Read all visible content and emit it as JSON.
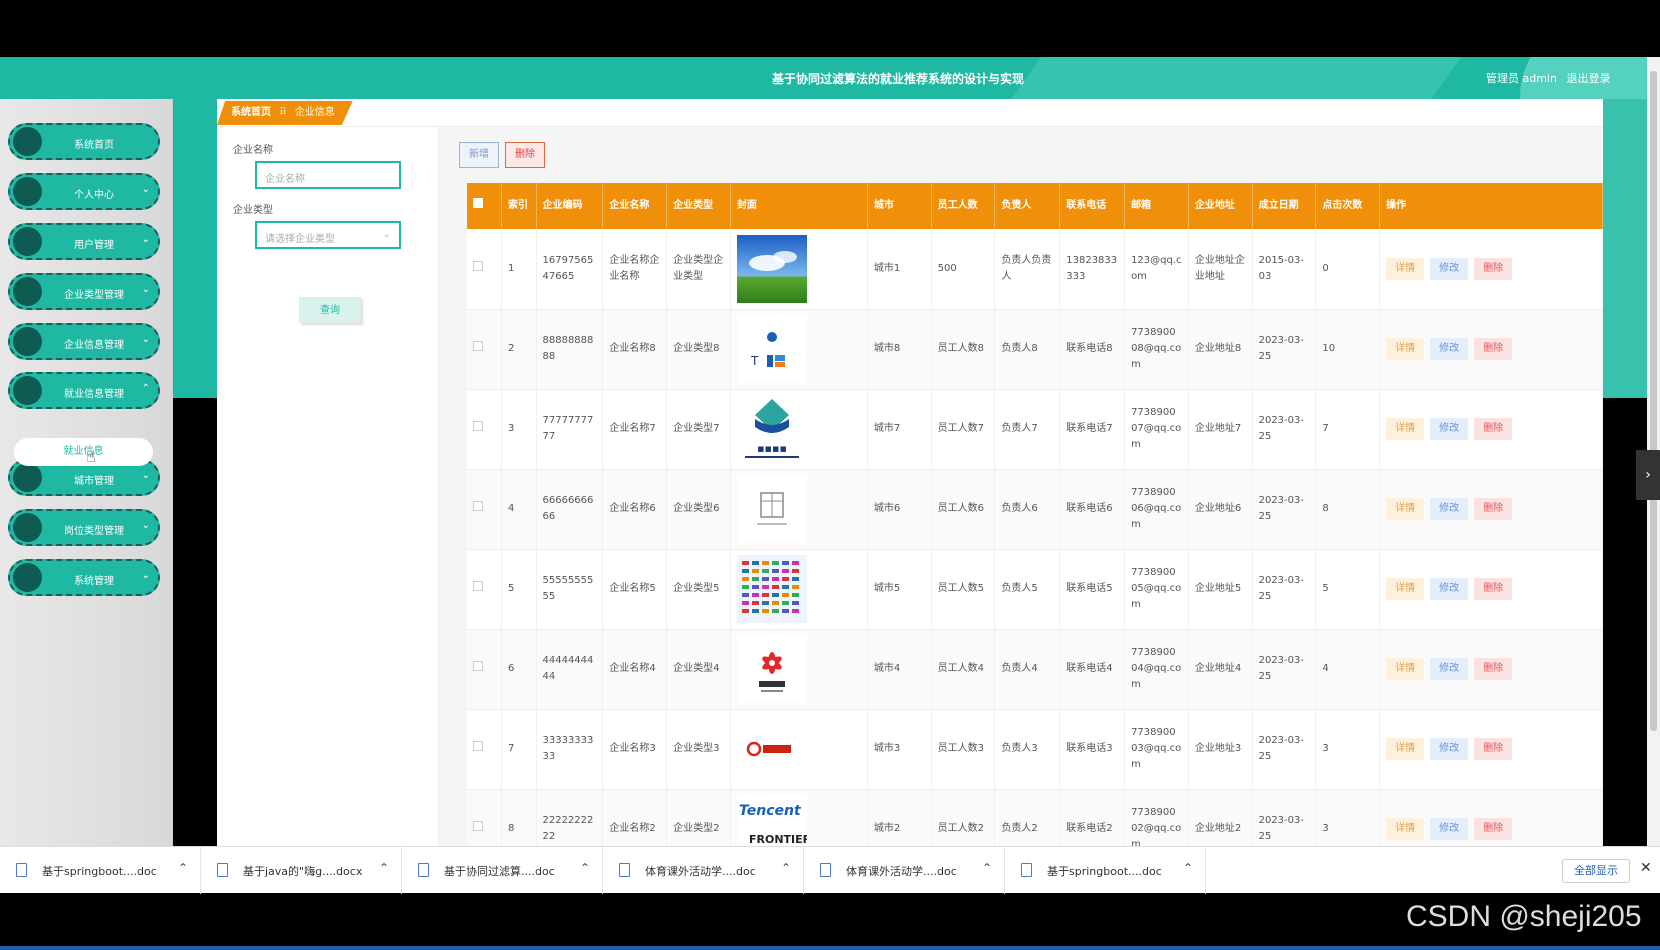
{
  "header": {
    "title": "基于协同过滤算法的就业推荐系统的设计与实现",
    "user": "管理员 admin",
    "logout": "退出登录"
  },
  "sidebar": {
    "items": [
      {
        "label": "系统首页"
      },
      {
        "label": "个人中心"
      },
      {
        "label": "用户管理"
      },
      {
        "label": "企业类型管理"
      },
      {
        "label": "企业信息管理"
      },
      {
        "label": "就业信息管理"
      },
      {
        "label": "城市管理"
      },
      {
        "label": "岗位类型管理"
      },
      {
        "label": "系统管理"
      }
    ],
    "sub_item": "就业信息"
  },
  "breadcrumb": {
    "home": "系统首页",
    "sep": "⠿",
    "current": "企业信息"
  },
  "search": {
    "name_label": "企业名称",
    "name_placeholder": "企业名称",
    "type_label": "企业类型",
    "type_placeholder": "请选择企业类型",
    "query": "查询"
  },
  "toolbar": {
    "add": "新增",
    "delete": "删除"
  },
  "table": {
    "headers": [
      "索引",
      "企业编码",
      "企业名称",
      "企业类型",
      "封面",
      "城市",
      "员工人数",
      "负责人",
      "联系电话",
      "邮箱",
      "企业地址",
      "成立日期",
      "点击次数",
      "操作"
    ],
    "ops": {
      "detail": "详情",
      "edit": "修改",
      "remove": "删除"
    },
    "rows": [
      {
        "idx": "1",
        "code": "1679756547665",
        "name": "企业名称企业名称",
        "type": "企业类型企业类型",
        "city": "城市1",
        "staff": "500",
        "owner": "负责人负责人",
        "phone": "13823833333",
        "email": "123@qq.com",
        "addr": "企业地址企业地址",
        "date": "2015-03-03",
        "clicks": "0",
        "cover": "sky"
      },
      {
        "idx": "2",
        "code": "8888888888",
        "name": "企业名称8",
        "type": "企业类型8",
        "city": "城市8",
        "staff": "员工人数8",
        "owner": "负责人8",
        "phone": "联系电话8",
        "email": "773890008@qq.com",
        "addr": "企业地址8",
        "date": "2023-03-25",
        "clicks": "10",
        "cover": "logo-t"
      },
      {
        "idx": "3",
        "code": "7777777777",
        "name": "企业名称7",
        "type": "企业类型7",
        "city": "城市7",
        "staff": "员工人数7",
        "owner": "负责人7",
        "phone": "联系电话7",
        "email": "773890007@qq.com",
        "addr": "企业地址7",
        "date": "2023-03-25",
        "clicks": "7",
        "cover": "zhishang"
      },
      {
        "idx": "4",
        "code": "6666666666",
        "name": "企业名称6",
        "type": "企业类型6",
        "city": "城市6",
        "staff": "员工人数6",
        "owner": "负责人6",
        "phone": "联系电话6",
        "email": "773890006@qq.com",
        "addr": "企业地址6",
        "date": "2023-03-25",
        "clicks": "8",
        "cover": "building"
      },
      {
        "idx": "5",
        "code": "5555555555",
        "name": "企业名称5",
        "type": "企业类型5",
        "city": "城市5",
        "staff": "员工人数5",
        "owner": "负责人5",
        "phone": "联系电话5",
        "email": "773890005@qq.com",
        "addr": "企业地址5",
        "date": "2023-03-25",
        "clicks": "5",
        "cover": "logos"
      },
      {
        "idx": "6",
        "code": "4444444444",
        "name": "企业名称4",
        "type": "企业类型4",
        "city": "城市4",
        "staff": "员工人数4",
        "owner": "负责人4",
        "phone": "联系电话4",
        "email": "773890004@qq.com",
        "addr": "企业地址4",
        "date": "2023-03-25",
        "clicks": "4",
        "cover": "flower"
      },
      {
        "idx": "7",
        "code": "3333333333",
        "name": "企业名称3",
        "type": "企业类型3",
        "city": "城市3",
        "staff": "员工人数3",
        "owner": "负责人3",
        "phone": "联系电话3",
        "email": "773890003@qq.com",
        "addr": "企业地址3",
        "date": "2023-03-25",
        "clicks": "3",
        "cover": "baidu"
      },
      {
        "idx": "8",
        "code": "2222222222",
        "name": "企业名称2",
        "type": "企业类型2",
        "city": "城市2",
        "staff": "员工人数2",
        "owner": "负责人2",
        "phone": "联系电话2",
        "email": "773890002@qq.com",
        "addr": "企业地址2",
        "date": "2023-03-25",
        "clicks": "3",
        "cover": "tencent"
      }
    ]
  },
  "downloads": {
    "items": [
      {
        "name": "基于springboot....doc"
      },
      {
        "name": "基于java的\"嗨g....docx"
      },
      {
        "name": "基于协同过滤算....doc"
      },
      {
        "name": "体育课外活动学....doc"
      },
      {
        "name": "体育课外活动学....doc"
      },
      {
        "name": "基于springboot....doc"
      }
    ],
    "show_all": "全部显示"
  },
  "watermark": "CSDN @sheji205",
  "colors": {
    "teal": "#1fb8a3",
    "orange": "#f0900a"
  }
}
